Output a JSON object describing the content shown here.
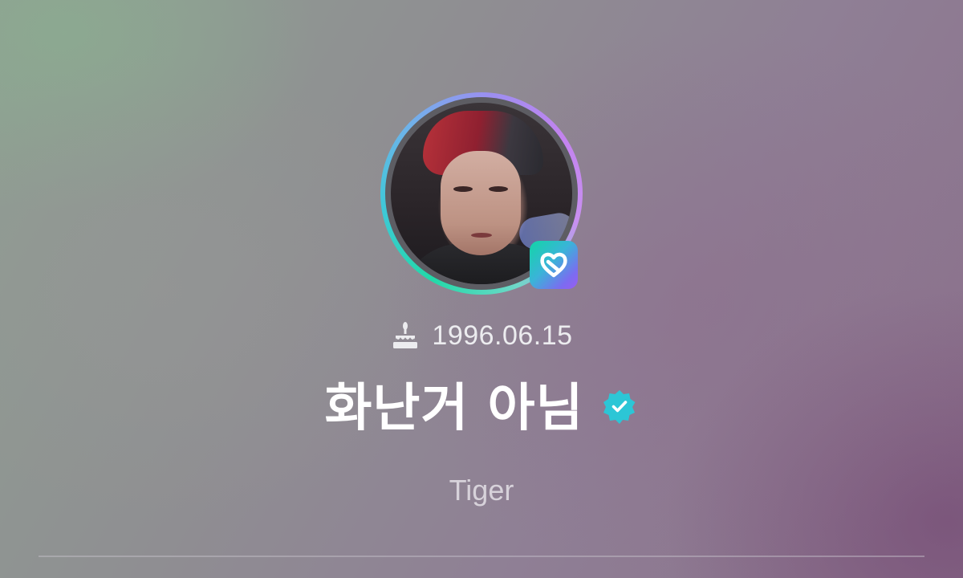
{
  "profile": {
    "birthday": "1996.06.15",
    "display_name": "화난거 아님",
    "nickname": "Tiger",
    "verified": true
  },
  "icons": {
    "birthday": "cake-icon",
    "verified": "verified-badge-icon",
    "app_badge": "weverse-heart-icon"
  },
  "colors": {
    "ring_start": "#22d9a8",
    "ring_end": "#c383ef",
    "verified": "#2cc6d6",
    "badge_start": "#12d6a6",
    "badge_end": "#9a5cf2"
  }
}
